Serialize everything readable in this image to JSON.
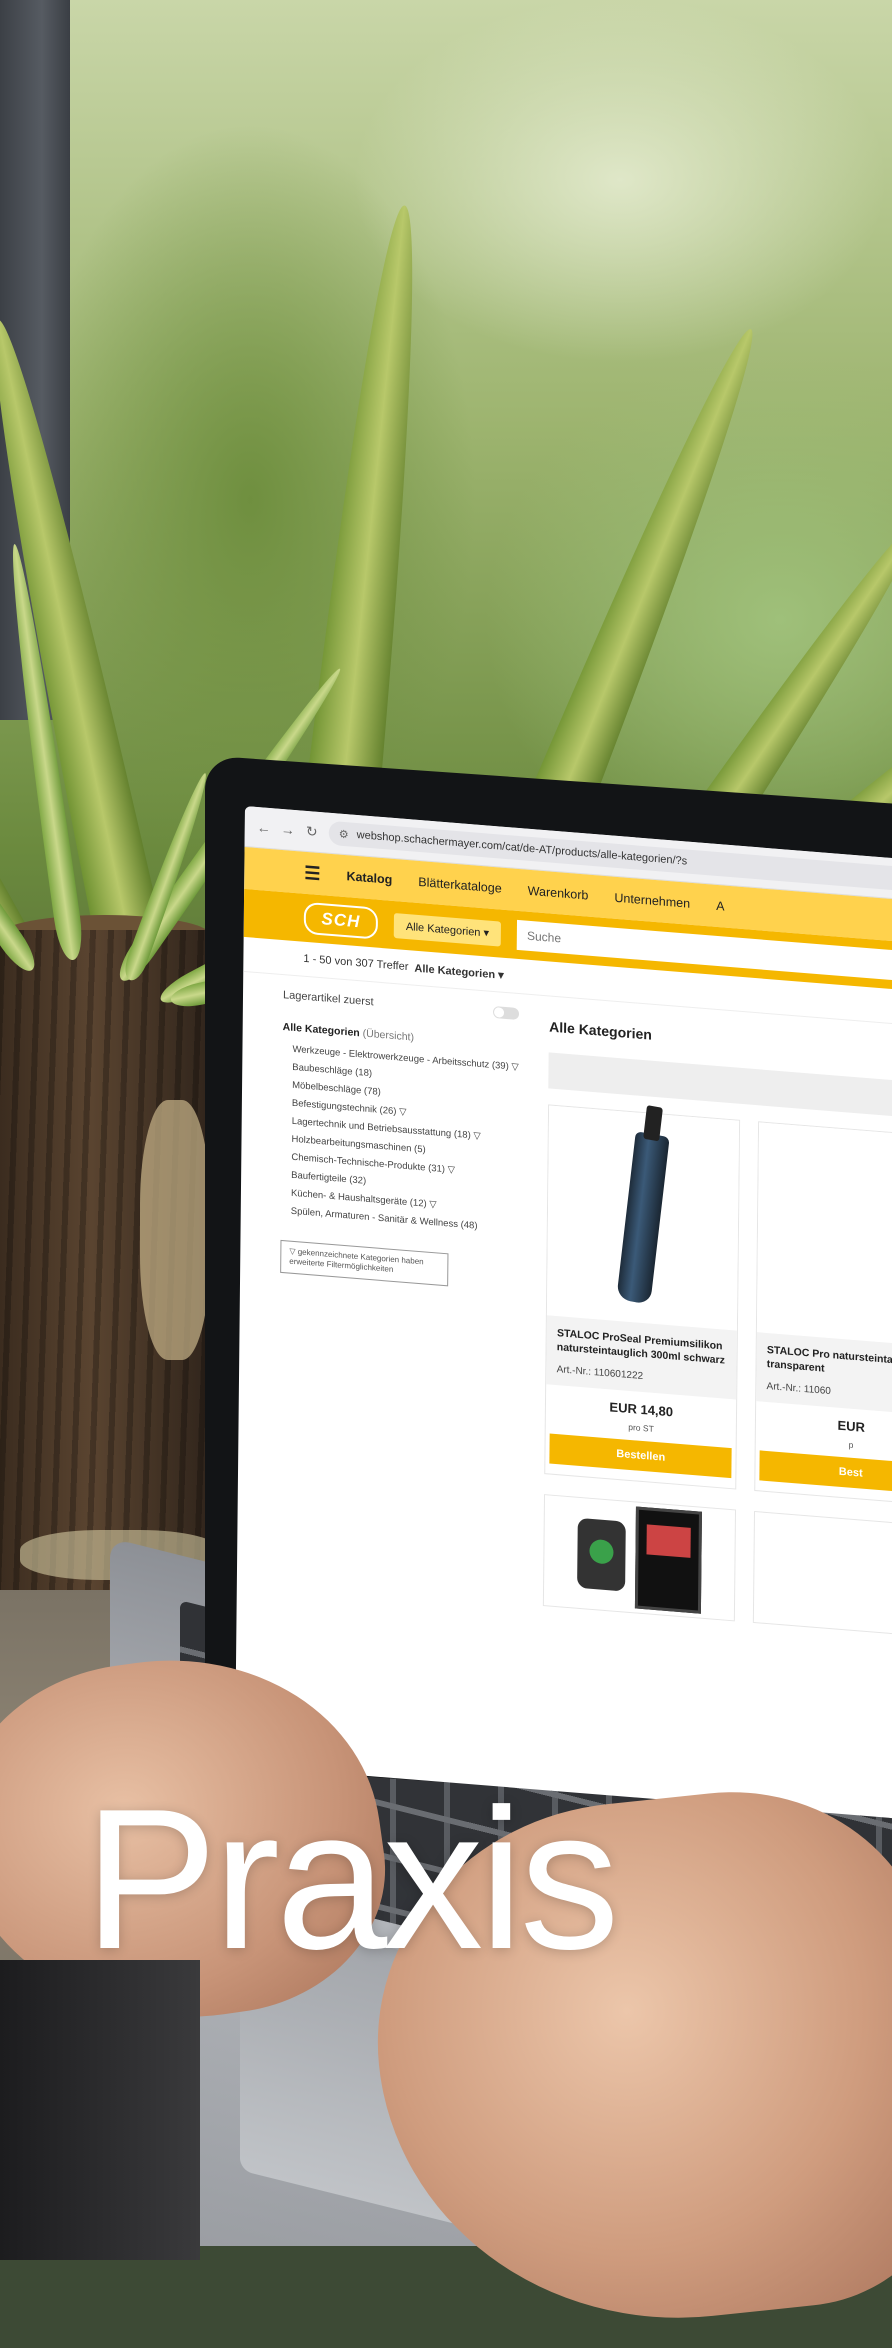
{
  "overlay": {
    "title": "Praxis"
  },
  "browser": {
    "url": "webshop.schachermayer.com/cat/de-AT/products/alle-kategorien/?s"
  },
  "shop": {
    "menu": [
      "Katalog",
      "Blätterkataloge",
      "Warenkorb",
      "Unternehmen",
      "A"
    ],
    "active_menu": "Katalog",
    "logo": "SCH",
    "category_select": "Alle Kategorien ▾",
    "search_placeholder": "Suche",
    "results_count": "1 - 50 von 307 Treffer",
    "results_filter": "Alle Kategorien ▾"
  },
  "sidebar": {
    "toggle_label": "Lagerartikel zuerst",
    "category_head": "Alle Kategorien",
    "category_head_note": "(Übersicht)",
    "categories": [
      "Werkzeuge - Elektrowerkzeuge - Arbeitsschutz (39) ▽",
      "Baubeschläge (18)",
      "Möbelbeschläge (78)",
      "Befestigungstechnik (26) ▽",
      "Lagertechnik und Betriebsausstattung (18) ▽",
      "Holzbearbeitungsmaschinen (5)",
      "Chemisch-Technische-Produkte (31) ▽",
      "Baufertigteile (32)",
      "Küchen- & Haushaltsgeräte (12) ▽",
      "Spülen, Armaturen - Sanitär & Wellness (48)"
    ],
    "filter_note": "▽ gekennzeichnete Kategorien haben erweiterte Filtermöglichkeiten"
  },
  "main": {
    "title": "Alle Kategorien",
    "products": [
      {
        "name": "STALOC ProSeal Premiumsilikon natursteintauglich 300ml schwarz",
        "artno": "Art.-Nr.: 110601222",
        "price": "EUR 14,80",
        "unit": "pro ST",
        "button": "Bestellen"
      },
      {
        "name": "STALOC Pro natursteinta transparent",
        "artno": "Art.-Nr.: 11060",
        "price": "EUR",
        "unit": "p",
        "button": "Best"
      }
    ]
  }
}
